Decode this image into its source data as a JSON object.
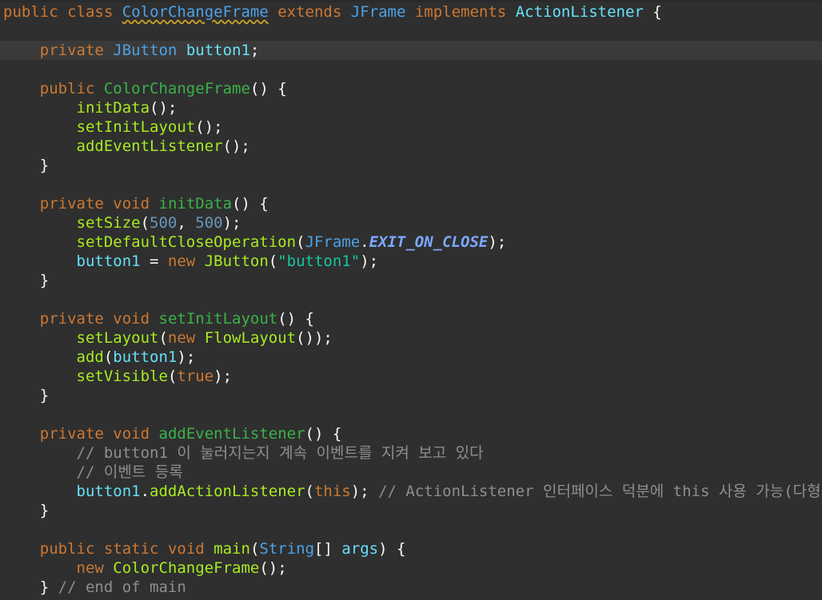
{
  "editor": {
    "current_line": 2,
    "lines": [
      [
        [
          "kw",
          "public"
        ],
        [
          "plain",
          " "
        ],
        [
          "kw",
          "class"
        ],
        [
          "plain",
          " "
        ],
        [
          "classSquiggle",
          "ColorChangeFrame"
        ],
        [
          "plain",
          " "
        ],
        [
          "kw",
          "extends"
        ],
        [
          "plain",
          " "
        ],
        [
          "type",
          "JFrame"
        ],
        [
          "plain",
          " "
        ],
        [
          "kw",
          "implements"
        ],
        [
          "plain",
          " "
        ],
        [
          "field",
          "ActionListener"
        ],
        [
          "plain",
          " {"
        ]
      ],
      [],
      [
        [
          "plain",
          "    "
        ],
        [
          "kw",
          "private"
        ],
        [
          "plain",
          " "
        ],
        [
          "type",
          "JButton"
        ],
        [
          "plain",
          " "
        ],
        [
          "field",
          "button1"
        ],
        [
          "plain",
          ";"
        ]
      ],
      [],
      [
        [
          "plain",
          "    "
        ],
        [
          "kw",
          "public"
        ],
        [
          "plain",
          " "
        ],
        [
          "def",
          "ColorChangeFrame"
        ],
        [
          "plain",
          "() {"
        ]
      ],
      [
        [
          "plain",
          "        "
        ],
        [
          "call",
          "initData"
        ],
        [
          "plain",
          "();"
        ]
      ],
      [
        [
          "plain",
          "        "
        ],
        [
          "call",
          "setInitLayout"
        ],
        [
          "plain",
          "();"
        ]
      ],
      [
        [
          "plain",
          "        "
        ],
        [
          "call",
          "addEventListener"
        ],
        [
          "plain",
          "();"
        ]
      ],
      [
        [
          "plain",
          "    }"
        ]
      ],
      [],
      [
        [
          "plain",
          "    "
        ],
        [
          "kw",
          "private"
        ],
        [
          "plain",
          " "
        ],
        [
          "kw",
          "void"
        ],
        [
          "plain",
          " "
        ],
        [
          "def",
          "initData"
        ],
        [
          "plain",
          "() {"
        ]
      ],
      [
        [
          "plain",
          "        "
        ],
        [
          "call",
          "setSize"
        ],
        [
          "plain",
          "("
        ],
        [
          "num",
          "500"
        ],
        [
          "plain",
          ", "
        ],
        [
          "num",
          "500"
        ],
        [
          "plain",
          ");"
        ]
      ],
      [
        [
          "plain",
          "        "
        ],
        [
          "call",
          "setDefaultCloseOperation"
        ],
        [
          "plain",
          "("
        ],
        [
          "type",
          "JFrame"
        ],
        [
          "plain",
          "."
        ],
        [
          "const",
          "EXIT_ON_CLOSE"
        ],
        [
          "plain",
          ");"
        ]
      ],
      [
        [
          "plain",
          "        "
        ],
        [
          "field",
          "button1"
        ],
        [
          "plain",
          " = "
        ],
        [
          "kw",
          "new"
        ],
        [
          "plain",
          " "
        ],
        [
          "call",
          "JButton"
        ],
        [
          "plain",
          "("
        ],
        [
          "str",
          "\"button1\""
        ],
        [
          "plain",
          ");"
        ]
      ],
      [
        [
          "plain",
          "    }"
        ]
      ],
      [],
      [
        [
          "plain",
          "    "
        ],
        [
          "kw",
          "private"
        ],
        [
          "plain",
          " "
        ],
        [
          "kw",
          "void"
        ],
        [
          "plain",
          " "
        ],
        [
          "def",
          "setInitLayout"
        ],
        [
          "plain",
          "() {"
        ]
      ],
      [
        [
          "plain",
          "        "
        ],
        [
          "call",
          "setLayout"
        ],
        [
          "plain",
          "("
        ],
        [
          "kw",
          "new"
        ],
        [
          "plain",
          " "
        ],
        [
          "call",
          "FlowLayout"
        ],
        [
          "plain",
          "());"
        ]
      ],
      [
        [
          "plain",
          "        "
        ],
        [
          "call",
          "add"
        ],
        [
          "plain",
          "("
        ],
        [
          "field",
          "button1"
        ],
        [
          "plain",
          ");"
        ]
      ],
      [
        [
          "plain",
          "        "
        ],
        [
          "call",
          "setVisible"
        ],
        [
          "plain",
          "("
        ],
        [
          "kw",
          "true"
        ],
        [
          "plain",
          ");"
        ]
      ],
      [
        [
          "plain",
          "    }"
        ]
      ],
      [],
      [
        [
          "plain",
          "    "
        ],
        [
          "kw",
          "private"
        ],
        [
          "plain",
          " "
        ],
        [
          "kw",
          "void"
        ],
        [
          "plain",
          " "
        ],
        [
          "def",
          "addEventListener"
        ],
        [
          "plain",
          "() {"
        ]
      ],
      [
        [
          "plain",
          "        "
        ],
        [
          "cmt",
          "// button1 이 눌러지는지 계속 이벤트를 지켜 보고 있다"
        ]
      ],
      [
        [
          "plain",
          "        "
        ],
        [
          "cmt",
          "// 이벤트 등록"
        ]
      ],
      [
        [
          "plain",
          "        "
        ],
        [
          "field",
          "button1"
        ],
        [
          "plain",
          "."
        ],
        [
          "call",
          "addActionListener"
        ],
        [
          "plain",
          "("
        ],
        [
          "kw",
          "this"
        ],
        [
          "plain",
          "); "
        ],
        [
          "cmt",
          "// ActionListener 인터페이스 덕분에 this 사용 가능(다형성)"
        ]
      ],
      [
        [
          "plain",
          "    }"
        ]
      ],
      [],
      [
        [
          "plain",
          "    "
        ],
        [
          "kw",
          "public"
        ],
        [
          "plain",
          " "
        ],
        [
          "kw",
          "static"
        ],
        [
          "plain",
          " "
        ],
        [
          "kw",
          "void"
        ],
        [
          "plain",
          " "
        ],
        [
          "call",
          "main"
        ],
        [
          "plain",
          "("
        ],
        [
          "type",
          "String"
        ],
        [
          "plain",
          "[] "
        ],
        [
          "field",
          "args"
        ],
        [
          "plain",
          ") {"
        ]
      ],
      [
        [
          "plain",
          "        "
        ],
        [
          "kw",
          "new"
        ],
        [
          "plain",
          " "
        ],
        [
          "call",
          "ColorChangeFrame"
        ],
        [
          "plain",
          "();"
        ]
      ],
      [
        [
          "plain",
          "    } "
        ],
        [
          "cmt",
          "// end of main"
        ]
      ]
    ]
  }
}
